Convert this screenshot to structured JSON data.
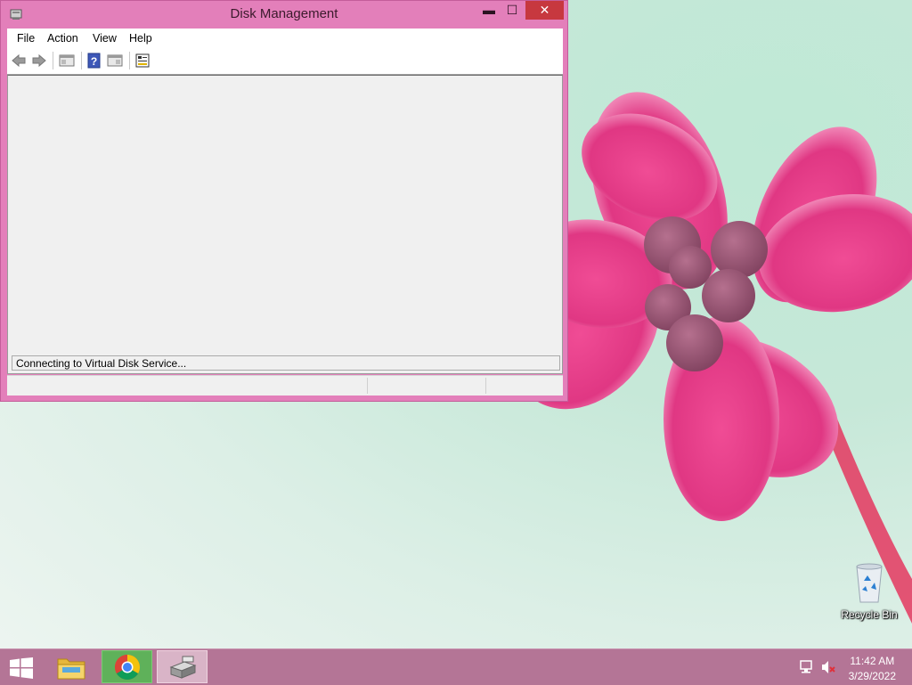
{
  "window": {
    "title": "Disk Management",
    "controls": {
      "minimize": "▬",
      "maximize": "☐",
      "close": "✕"
    },
    "menu": [
      "File",
      "Action",
      "View",
      "Help"
    ],
    "toolbar": [
      "back-icon",
      "forward-icon",
      "console-tree-icon",
      "help-icon",
      "action-pane-icon",
      "properties-icon"
    ],
    "status_message": "Connecting to Virtual Disk Service..."
  },
  "desktop": {
    "icons": [
      {
        "label": "Recycle Bin",
        "icon": "recycle-bin-icon"
      }
    ]
  },
  "taskbar": {
    "start_icon": "windows-logo-icon",
    "apps": [
      {
        "name": "file-explorer",
        "icon": "folder-icon"
      },
      {
        "name": "chrome",
        "icon": "chrome-icon"
      },
      {
        "name": "disk-management",
        "icon": "disk-management-icon"
      }
    ],
    "tray": {
      "network": "network-icon",
      "volume": "volume-muted-icon"
    },
    "clock": {
      "time": "11:42 AM",
      "date": "3/29/2022"
    }
  },
  "colors": {
    "window_frame": "#e37fba",
    "taskbar": "#b47596",
    "close_button": "#c7383f",
    "accent_flower": "#e0337d"
  }
}
